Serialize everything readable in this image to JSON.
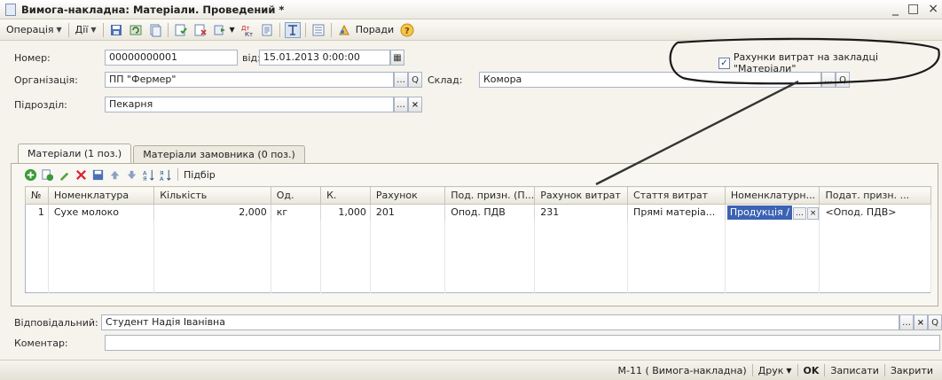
{
  "window": {
    "title": "Вимога-накладна: Матеріали. Проведений *",
    "controls": {
      "minimize": "_",
      "maximize": "□",
      "close": "×"
    }
  },
  "toolbar": {
    "operation_label": "Операція",
    "actions_label": "Дії",
    "hints_label": "Поради",
    "icons": [
      "save-icon",
      "refresh-icon",
      "copy-icon",
      "post-icon",
      "unpost-icon",
      "go-icon",
      "dtkt-icon",
      "journal-icon",
      "structure-icon",
      "list-icon",
      "hints-icon",
      "help-icon"
    ]
  },
  "form": {
    "number_label": "Номер:",
    "number_value": "00000000001",
    "date_label": "від:",
    "date_value": "15.01.2013  0:00:00",
    "org_label": "Організація:",
    "org_value": "ПП \"Фермер\"",
    "warehouse_label": "Склад:",
    "warehouse_value": "Комора",
    "subdiv_label": "Підрозділ:",
    "subdiv_value": "Пекарня",
    "expense_checkbox_label": "Рахунки витрат на закладці \"Матеріали\"",
    "expense_checkbox_checked": true,
    "responsible_label": "Відповідальний:",
    "responsible_value": "Студент Надія Іванівна",
    "comment_label": "Коментар:",
    "comment_value": ""
  },
  "tabs": [
    {
      "label": "Матеріали (1 поз.)",
      "active": true
    },
    {
      "label": "Матеріали замовника (0 поз.)",
      "active": false
    }
  ],
  "grid_toolbar": {
    "select_label": "Підбір"
  },
  "table": {
    "headers": [
      "№",
      "Номенклатура",
      "Кількість",
      "Од.",
      "К.",
      "Рахунок",
      "Под. призн. (П...",
      "Рахунок витрат",
      "Стаття витрат",
      "Номенклатурн...",
      "Подат. призн. ..."
    ],
    "rows": [
      [
        "1",
        "Сухе молоко",
        "2,000",
        "кг",
        "1,000",
        "201",
        "Опод. ПДВ",
        "231",
        "Прямі матеріа...",
        "Продукція /",
        "<Опод. ПДВ>"
      ]
    ]
  },
  "statusbar": {
    "print_form": "М-11 ( Вимога-накладна)",
    "print_label": "Друк",
    "ok_label": "OK",
    "save_label": "Записати",
    "close_label": "Закрити"
  }
}
